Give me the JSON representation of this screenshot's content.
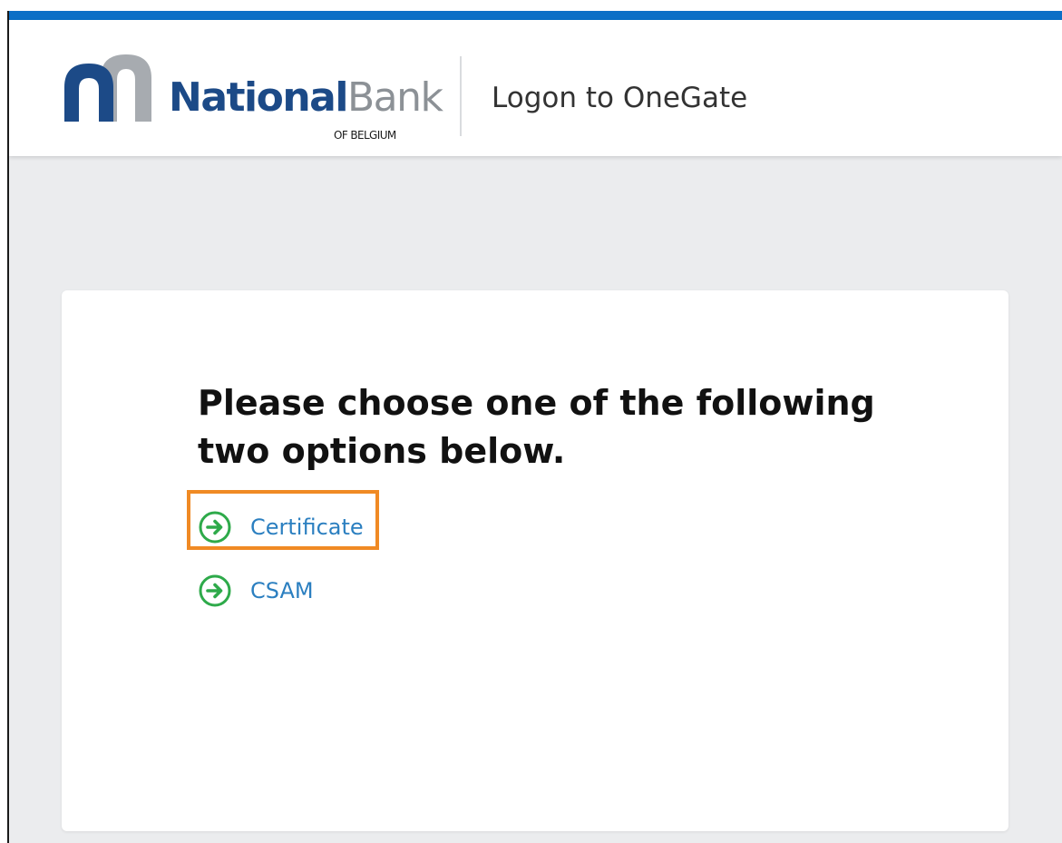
{
  "header": {
    "brand_primary": "National",
    "brand_secondary": "Bank",
    "brand_sub": "OF BELGIUM",
    "title": "Logon to OneGate"
  },
  "main": {
    "prompt": "Please choose one of the following two options below.",
    "options": [
      {
        "label": "Certificate",
        "icon": "arrow-right-circle-icon",
        "highlighted": true
      },
      {
        "label": "CSAM",
        "icon": "arrow-right-circle-icon",
        "highlighted": false
      }
    ]
  },
  "colors": {
    "top_bar": "#0b6fc6",
    "brand_blue": "#1c4a87",
    "brand_grey": "#8c9196",
    "link": "#2b7fc0",
    "icon_green": "#2eaa4a",
    "highlight": "#f08a24",
    "background": "#ebecee"
  }
}
